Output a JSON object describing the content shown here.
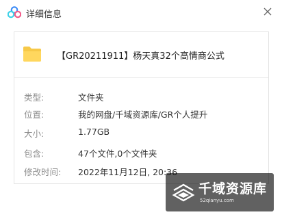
{
  "window": {
    "title": "详细信息",
    "app_icon": "baidu-netdisk-cloud-icon",
    "close_icon": "close-icon"
  },
  "file": {
    "icon": "folder-icon",
    "icon_color": "#F7C948",
    "name": "【GR20211911】杨天真32个高情商公式"
  },
  "details": {
    "type": {
      "label": "类型:",
      "value": "文件夹"
    },
    "location": {
      "label": "位置:",
      "value": "我的网盘/千域资源库/GR个人提升"
    },
    "size": {
      "label": "大小:",
      "value": "1.77GB"
    },
    "contains": {
      "label": "包含:",
      "value": "47个文件,0个文件夹"
    },
    "modified": {
      "label": "修改时间:",
      "value": "2022年11月12日, 20:36"
    }
  },
  "watermark": {
    "title": "千域资源库",
    "url": "52qianyu.com"
  },
  "colors": {
    "label_gray": "#8c8c8c",
    "text_dark": "#333333",
    "cloud_blue": "#3E8CF7",
    "cloud_cyan": "#3ED1E8",
    "cloud_pink": "#F25C8A"
  }
}
